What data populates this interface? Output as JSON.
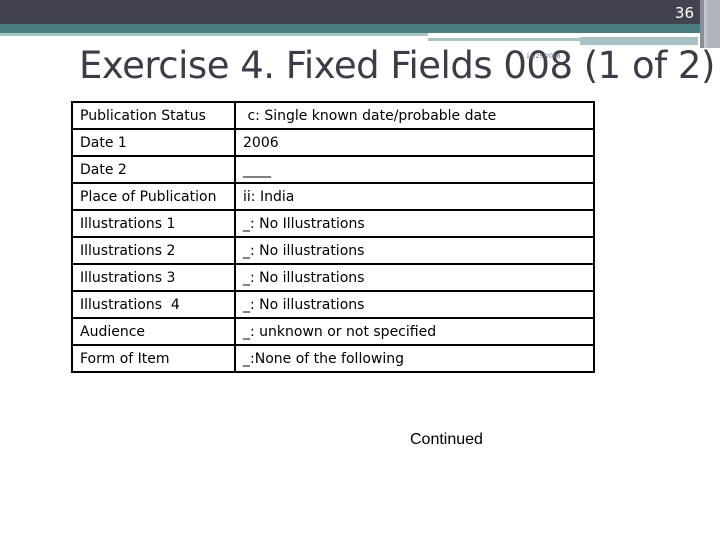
{
  "slide": {
    "number": "36",
    "title": "Exercise 4. Fixed Fields 008 (1 of 2)",
    "date_stamp": "11/25/2008",
    "footer_note": "Continued"
  },
  "colors": {
    "header_dark": "#43434f",
    "header_teal": "#477f81",
    "header_light": "#a8c3c5",
    "title_text": "#3c3c48"
  },
  "table": {
    "rows": [
      {
        "field": "Publication Status",
        "value": " c: Single known date/probable date"
      },
      {
        "field": "Date 1",
        "value": "2006"
      },
      {
        "field": "Date 2",
        "value": "____"
      },
      {
        "field": "Place of Publication",
        "value": "ii: India"
      },
      {
        "field": "Illustrations 1",
        "value": "_: No Illustrations"
      },
      {
        "field": "Illustrations 2",
        "value": "_: No illustrations"
      },
      {
        "field": "Illustrations 3",
        "value": "_: No illustrations"
      },
      {
        "field": "Illustrations  4",
        "value": "_: No illustrations"
      },
      {
        "field": "Audience",
        "value": "_: unknown or not specified"
      },
      {
        "field": "Form of Item",
        "value": "_:None of the following"
      }
    ]
  }
}
